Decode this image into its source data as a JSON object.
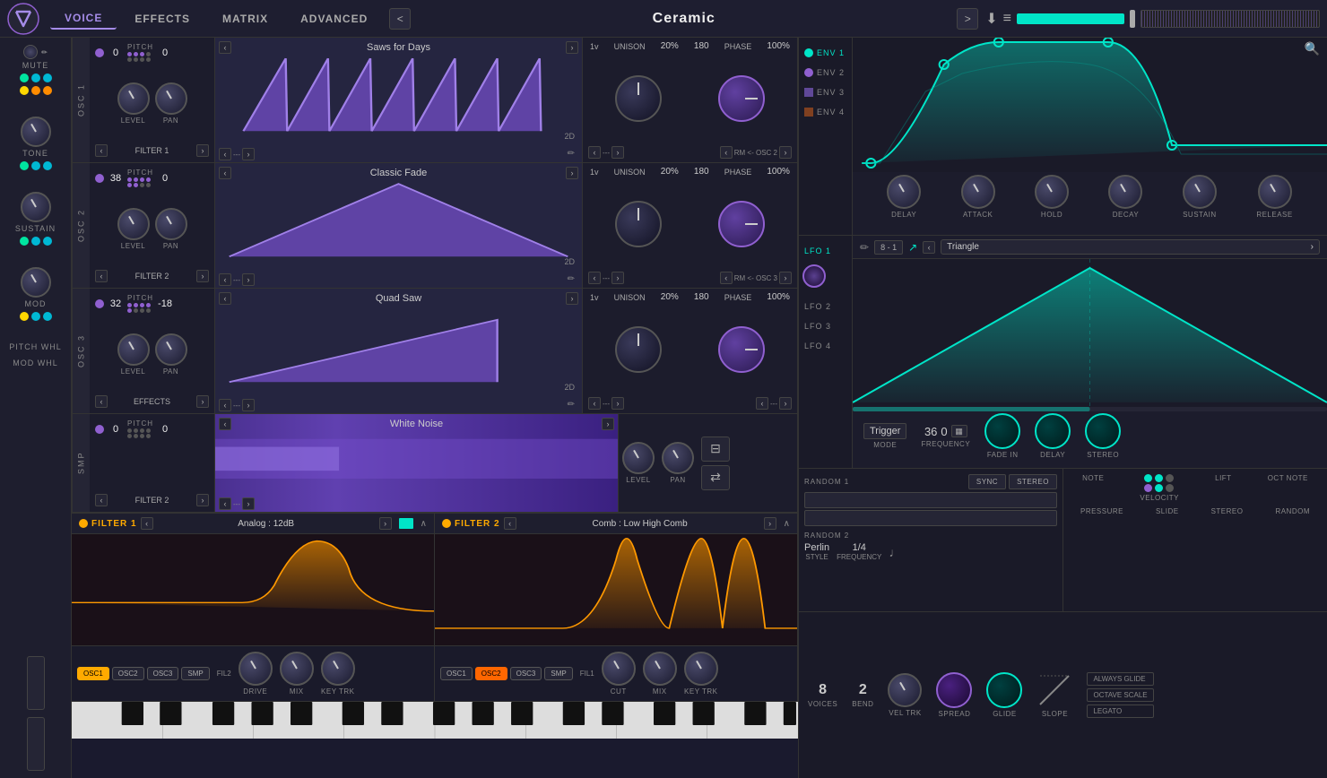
{
  "app": {
    "logo": "V",
    "nav_tabs": [
      "VOICE",
      "EFFECTS",
      "MATRIX",
      "ADVANCED"
    ],
    "active_tab": "VOICE",
    "preset_name": "Ceramic",
    "arrow_left": "<",
    "arrow_right": ">"
  },
  "sidebar": {
    "knobs": [
      "MUTE",
      "TONE",
      "SUSTAIN",
      "MOD",
      "PITCH WHL",
      "MOD WHL"
    ]
  },
  "osc": [
    {
      "id": "OSC 1",
      "pitch_left": "0",
      "pitch_right": "0",
      "filter": "FILTER 1",
      "wave_name": "Saws for Days",
      "knob_level": 40,
      "knob_pan": 0,
      "unison": "1v",
      "unison_pct": "20%",
      "phase": "180",
      "phase_pct": "100%",
      "rm": "RM <- OSC 2"
    },
    {
      "id": "OSC 2",
      "pitch_left": "38",
      "pitch_right": "0",
      "filter": "FILTER 2",
      "wave_name": "Classic Fade",
      "knob_level": 40,
      "knob_pan": 0,
      "unison": "1v",
      "unison_pct": "20%",
      "phase": "180",
      "phase_pct": "100%",
      "rm": "RM <- OSC 3"
    },
    {
      "id": "OSC 3",
      "pitch_left": "32",
      "pitch_right": "-18",
      "filter": "EFFECTS",
      "wave_name": "Quad Saw",
      "knob_level": 40,
      "knob_pan": 0,
      "unison": "1v",
      "unison_pct": "20%",
      "phase": "180",
      "phase_pct": "100%",
      "rm": "---"
    },
    {
      "id": "SMP",
      "pitch_left": "0",
      "pitch_right": "0",
      "filter": "FILTER 2",
      "wave_name": "White Noise",
      "knob_level": 40,
      "knob_pan": 0
    }
  ],
  "filter1": {
    "title": "FILTER 1",
    "type": "Analog : 12dB",
    "oscs": [
      "OSC1",
      "OSC2",
      "OSC3",
      "SMP"
    ],
    "active": [
      "OSC1"
    ],
    "label": "FIL2",
    "drive_label": "DRIVE",
    "mix_label": "MIX",
    "keytrk_label": "KEY TRK"
  },
  "filter2": {
    "title": "FILTER 2",
    "type": "Comb : Low High Comb",
    "oscs": [
      "OSC1",
      "OSC2",
      "OSC3",
      "SMP"
    ],
    "active": [
      "OSC2"
    ],
    "label": "FIL1",
    "cut_label": "CUT",
    "mix_label": "MIX",
    "keytrk_label": "KEY TRK"
  },
  "env": {
    "items": [
      "ENV 1",
      "ENV 2",
      "ENV 3",
      "ENV 4"
    ],
    "active": "ENV 1",
    "knob_labels": [
      "DELAY",
      "ATTACK",
      "HOLD",
      "DECAY",
      "SUSTAIN",
      "RELEASE"
    ]
  },
  "lfo": {
    "items": [
      "LFO 1",
      "LFO 2",
      "LFO 3",
      "LFO 4"
    ],
    "active": "LFO 1",
    "rate": "8",
    "rate2": "1",
    "wave": "Triangle",
    "controls": {
      "mode_label": "MODE",
      "mode_val": "Trigger",
      "freq_label": "FREQUENCY",
      "freq_val": "36",
      "freq_val2": "0",
      "fade_label": "FADE IN",
      "delay_label": "DELAY",
      "stereo_label": "STEREO"
    }
  },
  "random": {
    "items": [
      "RANDOM 1",
      "RANDOM 2"
    ],
    "r1_btns": [
      "SYNC",
      "STEREO"
    ],
    "r2_style": "Perlin",
    "r2_freq": "1/4",
    "style_label": "STYLE",
    "freq_label": "FREQUENCY"
  },
  "bottom_right": {
    "note_label": "NOTE",
    "velocity_label": "VELOCITY",
    "lift_label": "LIFT",
    "oct_note_label": "OCT NOTE",
    "pressure_label": "PRESSURE",
    "slide_label": "SLIDE",
    "stereo_label": "STEREO",
    "random_label": "RANDOM",
    "voices_label": "VOICES",
    "voices_val": "8",
    "bend_label": "BEND",
    "bend_val": "2",
    "vel_trk_label": "VEL TRK",
    "spread_label": "SPREAD",
    "glide_label": "GLIDE",
    "slope_label": "SLOPE",
    "always_glide": "ALWAYS GLIDE",
    "octave_scale": "OCTAVE SCALE",
    "legato": "LEGATO"
  }
}
